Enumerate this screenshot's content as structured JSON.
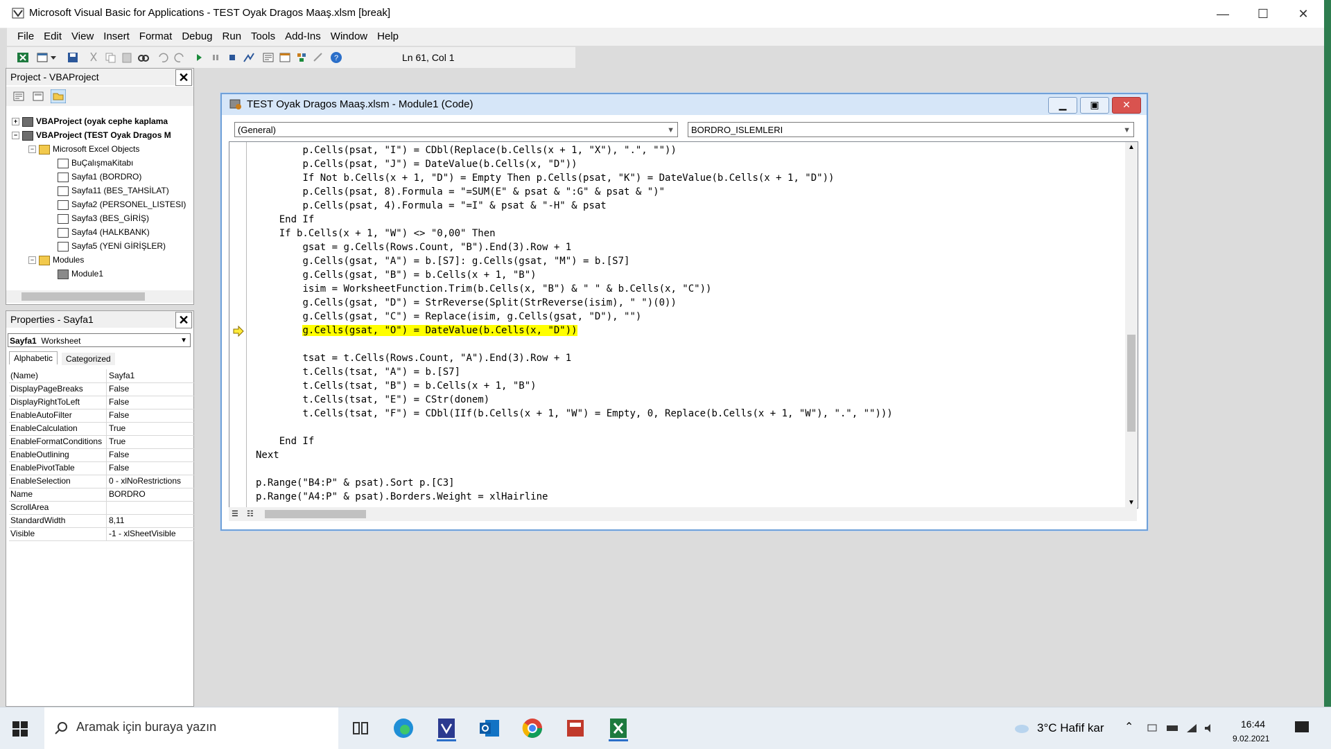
{
  "window": {
    "title": "Microsoft Visual Basic for Applications - TEST Oyak Dragos Maaş.xlsm [break]",
    "minimize": "—",
    "maximize": "☐",
    "close": "✕"
  },
  "menu": [
    "File",
    "Edit",
    "View",
    "Insert",
    "Format",
    "Debug",
    "Run",
    "Tools",
    "Add-Ins",
    "Window",
    "Help"
  ],
  "toolbar": {
    "position": "Ln 61, Col 1"
  },
  "project": {
    "title": "Project - VBAProject",
    "tree": [
      "VBAProject (oyak cephe kaplama",
      "VBAProject (TEST Oyak Dragos M",
      "Microsoft Excel Objects",
      "BuÇalışmaKitabı",
      "Sayfa1 (BORDRO)",
      "Sayfa11 (BES_TAHSİLAT)",
      "Sayfa2 (PERSONEL_LISTESI)",
      "Sayfa3 (BES_GİRİŞ)",
      "Sayfa4 (HALKBANK)",
      "Sayfa5 (YENİ GİRİŞLER)",
      "Modules",
      "Module1"
    ]
  },
  "properties": {
    "title": "Properties - Sayfa1",
    "object": "Sayfa1",
    "object_type": "Worksheet",
    "tab_alpha": "Alphabetic",
    "tab_cat": "Categorized",
    "rows": [
      [
        "(Name)",
        "Sayfa1"
      ],
      [
        "DisplayPageBreaks",
        "False"
      ],
      [
        "DisplayRightToLeft",
        "False"
      ],
      [
        "EnableAutoFilter",
        "False"
      ],
      [
        "EnableCalculation",
        "True"
      ],
      [
        "EnableFormatConditionsCalculation",
        "True"
      ],
      [
        "EnableOutlining",
        "False"
      ],
      [
        "EnablePivotTable",
        "False"
      ],
      [
        "EnableSelection",
        "0 - xlNoRestrictions"
      ],
      [
        "Name",
        "BORDRO"
      ],
      [
        "ScrollArea",
        ""
      ],
      [
        "StandardWidth",
        "8,11"
      ],
      [
        "Visible",
        "-1 - xlSheetVisible"
      ]
    ]
  },
  "code": {
    "title": "TEST Oyak Dragos Maaş.xlsm - Module1 (Code)",
    "object_combo": "(General)",
    "proc_combo": "BORDRO_ISLEMLERI",
    "lines": [
      "        p.Cells(psat, \"I\") = CDbl(Replace(b.Cells(x + 1, \"X\"), \".\", \"\"))",
      "        p.Cells(psat, \"J\") = DateValue(b.Cells(x, \"D\"))",
      "        If Not b.Cells(x + 1, \"D\") = Empty Then p.Cells(psat, \"K\") = DateValue(b.Cells(x + 1, \"D\"))",
      "        p.Cells(psat, 8).Formula = \"=SUM(E\" & psat & \":G\" & psat & \")\"",
      "        p.Cells(psat, 4).Formula = \"=I\" & psat & \"-H\" & psat",
      "    End If",
      "    If b.Cells(x + 1, \"W\") <> \"0,00\" Then",
      "        gsat = g.Cells(Rows.Count, \"B\").End(3).Row + 1",
      "        g.Cells(gsat, \"A\") = b.[S7]: g.Cells(gsat, \"M\") = b.[S7]",
      "        g.Cells(gsat, \"B\") = b.Cells(x + 1, \"B\")",
      "        isim = WorksheetFunction.Trim(b.Cells(x, \"B\") & \" \" & b.Cells(x, \"C\"))",
      "        g.Cells(gsat, \"D\") = StrReverse(Split(StrReverse(isim), \" \")(0))",
      "        g.Cells(gsat, \"C\") = Replace(isim, g.Cells(gsat, \"D\"), \"\")",
      "        g.Cells(gsat, \"O\") = DateValue(b.Cells(x, \"D\"))",
      "",
      "        tsat = t.Cells(Rows.Count, \"A\").End(3).Row + 1",
      "        t.Cells(tsat, \"A\") = b.[S7]",
      "        t.Cells(tsat, \"B\") = b.Cells(x + 1, \"B\")",
      "        t.Cells(tsat, \"E\") = CStr(donem)",
      "        t.Cells(tsat, \"F\") = CDbl(IIf(b.Cells(x + 1, \"W\") = Empty, 0, Replace(b.Cells(x + 1, \"W\"), \".\", \"\")))",
      "",
      "    End If",
      "Next",
      "",
      "p.Range(\"B4:P\" & psat).Sort p.[C3]",
      "p.Range(\"A4:P\" & psat).Borders.Weight = xlHairline"
    ],
    "highlight_line": 13
  },
  "taskbar": {
    "search_placeholder": "Aramak için buraya yazın",
    "weather": "3°C  Hafif kar",
    "time": "16:44",
    "date": "9.02.2021"
  }
}
